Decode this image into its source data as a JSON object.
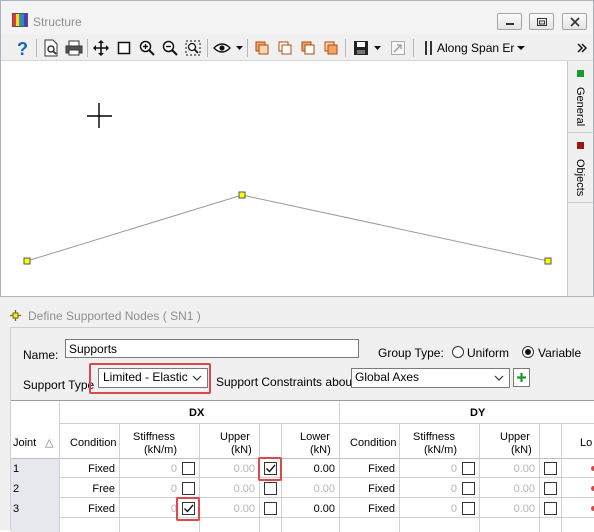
{
  "structure_window": {
    "title": "Structure",
    "toolbar": {
      "load_case_label": "Along Span Er",
      "items": [
        "help-icon",
        "print-preview-icon",
        "print-icon",
        "pan-icon",
        "select-box-icon",
        "zoom-in-icon",
        "zoom-out-icon",
        "zoom-extents-icon",
        "view-icon",
        "copy-icon",
        "paste-icon",
        "report-icon",
        "save-icon",
        "export-icon"
      ]
    },
    "side_tabs": [
      {
        "label": "General",
        "color": "#1a9a2e"
      },
      {
        "label": "Objects",
        "color": "#a01414"
      }
    ]
  },
  "dialog": {
    "title": "Define Supported Nodes ( SN1 )",
    "name_label": "Name:",
    "name_value": "Supports",
    "group_type_label": "Group Type:",
    "group_type_options": [
      "Uniform",
      "Variable"
    ],
    "group_type_selected": "Variable",
    "support_type_label": "Support Type",
    "support_type_value": "Limited - Elastic",
    "constraints_label": "Support Constraints about:",
    "constraints_value": "Global Axes",
    "grid": {
      "group_headers": [
        "DX",
        "DY"
      ],
      "columns": [
        "Joint",
        "Condition",
        "Stiffness (kN/m)",
        "Upper (kN)",
        "Lower (kN)",
        "Condition",
        "Stiffness (kN/m)",
        "Upper (kN)",
        "Lower"
      ],
      "sort_glyph": "△",
      "stiffness_label_1": "Stiffness",
      "stiffness_label_2": "(kN/m)",
      "upper_label_1": "Upper",
      "upper_label_2": "(kN)",
      "lower_label_1": "Lower",
      "lower_label_2": "(kN)",
      "lower_label_cut": "Lo",
      "rows": [
        {
          "joint": "1",
          "dx_condition": "Fixed",
          "dx_stiffness": "0",
          "dx_stiffness_checked": false,
          "dx_upper": "0.00",
          "dx_upper_checked": true,
          "dx_lower": "0.00",
          "dy_condition": "Fixed",
          "dy_stiffness": "0",
          "dy_upper": "0.00"
        },
        {
          "joint": "2",
          "dx_condition": "Free",
          "dx_stiffness": "0",
          "dx_stiffness_checked": false,
          "dx_upper": "0.00",
          "dx_upper_checked": false,
          "dx_lower": "0.00",
          "dy_condition": "Fixed",
          "dy_stiffness": "0",
          "dy_upper": "0.00"
        },
        {
          "joint": "3",
          "dx_condition": "Fixed",
          "dx_stiffness": "0",
          "dx_stiffness_checked": true,
          "dx_upper": "0.00",
          "dx_upper_checked": false,
          "dx_lower": "0.00",
          "dy_condition": "Fixed",
          "dy_stiffness": "0",
          "dy_upper": "0.00"
        }
      ]
    }
  },
  "colors": {
    "highlight": "#e0474c",
    "node": "#ffff00",
    "add_green": "#1a9a2e"
  }
}
